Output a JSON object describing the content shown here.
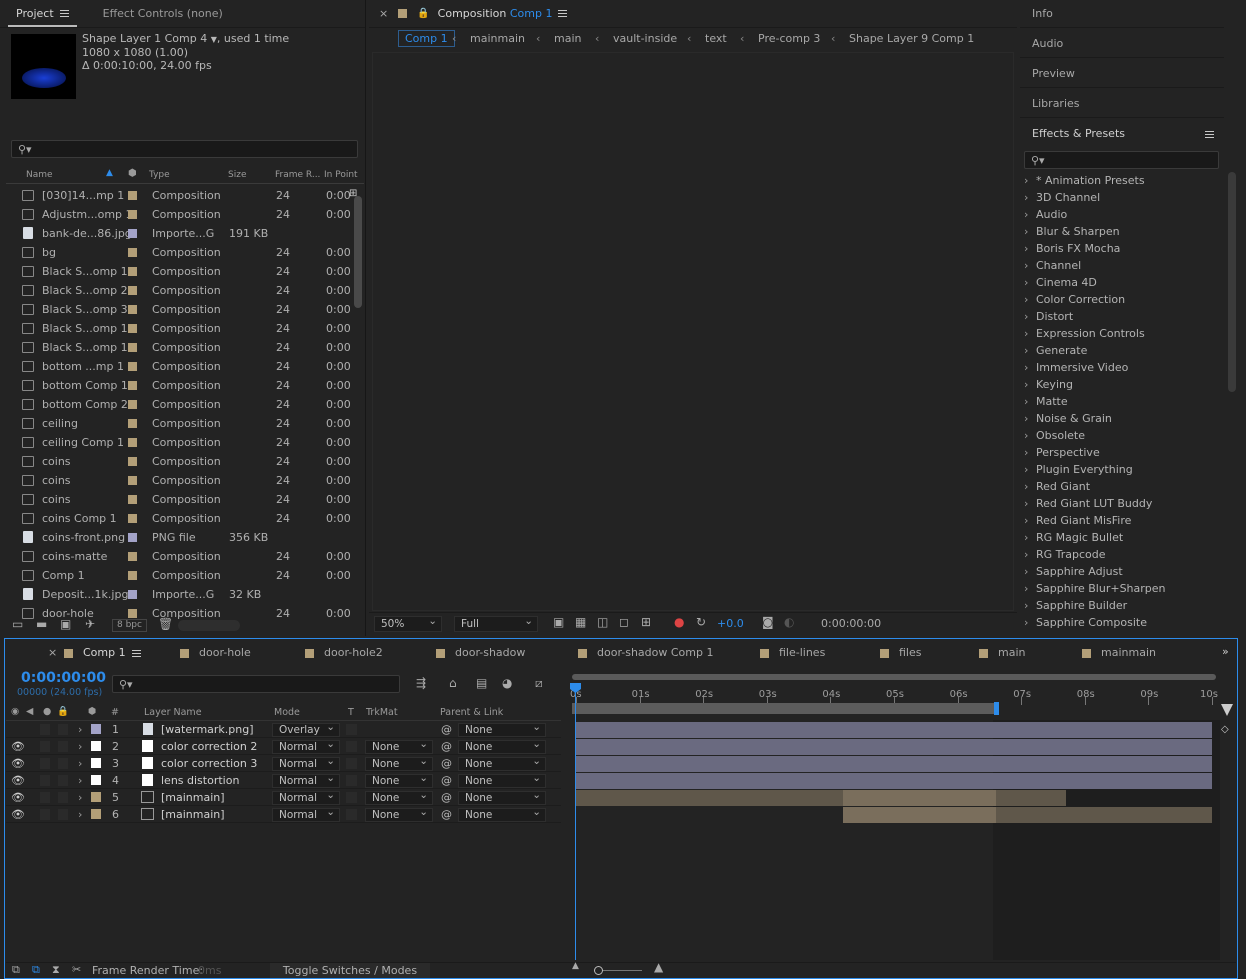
{
  "project_panel": {
    "tab_project": "Project",
    "tab_effect_controls": "Effect Controls (none)",
    "comp_name": "Shape Layer 1 Comp 4",
    "comp_used": ", used 1 time",
    "comp_res": "1080 x 1080 (1.00)",
    "comp_dur": "Δ 0:00:10:00, 24.00 fps",
    "columns": [
      "Name",
      "Type",
      "Size",
      "Frame R...",
      "In Point"
    ],
    "items": [
      {
        "name": "[030]14...mp 1",
        "type": "Composition",
        "size": "",
        "fr": "24",
        "in": "0:00",
        "icon": "comp",
        "color": "#b39f78"
      },
      {
        "name": "Adjustm...omp 1",
        "type": "Composition",
        "size": "",
        "fr": "24",
        "in": "0:00",
        "icon": "comp",
        "color": "#b39f78"
      },
      {
        "name": "bank-de...86.jpg",
        "type": "Importe...G",
        "size": "191 KB",
        "fr": "",
        "in": "",
        "icon": "file",
        "color": "#a3a3c8"
      },
      {
        "name": "bg",
        "type": "Composition",
        "size": "",
        "fr": "24",
        "in": "0:00",
        "icon": "comp",
        "color": "#b39f78"
      },
      {
        "name": "Black S...omp 1",
        "type": "Composition",
        "size": "",
        "fr": "24",
        "in": "0:00",
        "icon": "comp",
        "color": "#b39f78"
      },
      {
        "name": "Black S...omp 2",
        "type": "Composition",
        "size": "",
        "fr": "24",
        "in": "0:00",
        "icon": "comp",
        "color": "#b39f78"
      },
      {
        "name": "Black S...omp 3",
        "type": "Composition",
        "size": "",
        "fr": "24",
        "in": "0:00",
        "icon": "comp",
        "color": "#b39f78"
      },
      {
        "name": "Black S...omp 1",
        "type": "Composition",
        "size": "",
        "fr": "24",
        "in": "0:00",
        "icon": "comp",
        "color": "#b39f78"
      },
      {
        "name": "Black S...omp 1",
        "type": "Composition",
        "size": "",
        "fr": "24",
        "in": "0:00",
        "icon": "comp",
        "color": "#b39f78"
      },
      {
        "name": "bottom ...mp 1",
        "type": "Composition",
        "size": "",
        "fr": "24",
        "in": "0:00",
        "icon": "comp",
        "color": "#b39f78"
      },
      {
        "name": "bottom Comp 1",
        "type": "Composition",
        "size": "",
        "fr": "24",
        "in": "0:00",
        "icon": "comp",
        "color": "#b39f78"
      },
      {
        "name": "bottom Comp 2",
        "type": "Composition",
        "size": "",
        "fr": "24",
        "in": "0:00",
        "icon": "comp",
        "color": "#b39f78"
      },
      {
        "name": "ceiling",
        "type": "Composition",
        "size": "",
        "fr": "24",
        "in": "0:00",
        "icon": "comp",
        "color": "#b39f78"
      },
      {
        "name": "ceiling Comp 1",
        "type": "Composition",
        "size": "",
        "fr": "24",
        "in": "0:00",
        "icon": "comp",
        "color": "#b39f78"
      },
      {
        "name": "coins",
        "type": "Composition",
        "size": "",
        "fr": "24",
        "in": "0:00",
        "icon": "comp",
        "color": "#b39f78"
      },
      {
        "name": "coins",
        "type": "Composition",
        "size": "",
        "fr": "24",
        "in": "0:00",
        "icon": "comp",
        "color": "#b39f78"
      },
      {
        "name": "coins",
        "type": "Composition",
        "size": "",
        "fr": "24",
        "in": "0:00",
        "icon": "comp",
        "color": "#b39f78"
      },
      {
        "name": "coins Comp 1",
        "type": "Composition",
        "size": "",
        "fr": "24",
        "in": "0:00",
        "icon": "comp",
        "color": "#b39f78"
      },
      {
        "name": "coins-front.png",
        "type": "PNG file",
        "size": "356 KB",
        "fr": "",
        "in": "",
        "icon": "file",
        "color": "#a3a3c8"
      },
      {
        "name": "coins-matte",
        "type": "Composition",
        "size": "",
        "fr": "24",
        "in": "0:00",
        "icon": "comp",
        "color": "#b39f78"
      },
      {
        "name": "Comp 1",
        "type": "Composition",
        "size": "",
        "fr": "24",
        "in": "0:00",
        "icon": "comp",
        "color": "#b39f78"
      },
      {
        "name": "Deposit...1k.jpg",
        "type": "Importe...G",
        "size": "32 KB",
        "fr": "",
        "in": "",
        "icon": "file",
        "color": "#a3a3c8"
      },
      {
        "name": "door-hole",
        "type": "Composition",
        "size": "",
        "fr": "24",
        "in": "0:00",
        "icon": "comp",
        "color": "#b39f78"
      }
    ],
    "bpc": "8 bpc"
  },
  "composition_panel": {
    "tab_prefix": "Composition",
    "tab_name": "Comp 1",
    "breadcrumbs": [
      "Comp 1",
      "mainmain",
      "main",
      "vault-inside",
      "text",
      "Pre-comp 3",
      "Shape Layer 9 Comp 1"
    ],
    "zoom": "50%",
    "resolution": "Full",
    "exposure": "+0.0",
    "timecode": "0:00:00:00"
  },
  "right_panel": {
    "tabs": [
      "Info",
      "Audio",
      "Preview",
      "Libraries"
    ],
    "effects_title": "Effects & Presets",
    "effects": [
      "* Animation Presets",
      "3D Channel",
      "Audio",
      "Blur & Sharpen",
      "Boris FX Mocha",
      "Channel",
      "Cinema 4D",
      "Color Correction",
      "Distort",
      "Expression Controls",
      "Generate",
      "Immersive Video",
      "Keying",
      "Matte",
      "Noise & Grain",
      "Obsolete",
      "Perspective",
      "Plugin Everything",
      "Red Giant",
      "Red Giant LUT Buddy",
      "Red Giant MisFire",
      "RG Magic Bullet",
      "RG Trapcode",
      "Sapphire Adjust",
      "Sapphire Blur+Sharpen",
      "Sapphire Builder",
      "Sapphire Composite"
    ]
  },
  "timeline": {
    "tabs": [
      {
        "label": "Comp 1",
        "color": "#b39f78",
        "active": true
      },
      {
        "label": "door-hole",
        "color": "#b39f78"
      },
      {
        "label": "door-hole2",
        "color": "#b39f78"
      },
      {
        "label": "door-shadow",
        "color": "#b39f78"
      },
      {
        "label": "door-shadow Comp 1",
        "color": "#b39f78"
      },
      {
        "label": "file-lines",
        "color": "#b39f78"
      },
      {
        "label": "files",
        "color": "#b39f78"
      },
      {
        "label": "main",
        "color": "#b39f78"
      },
      {
        "label": "mainmain",
        "color": "#b39f78"
      }
    ],
    "timecode": "0:00:00:00",
    "frames": "00000 (24.00 fps)",
    "columns": {
      "layer_name": "Layer Name",
      "mode": "Mode",
      "t": "T",
      "trkmat": "TrkMat",
      "parent": "Parent & Link",
      "num": "#"
    },
    "ruler": [
      "0s",
      "01s",
      "02s",
      "03s",
      "04s",
      "05s",
      "06s",
      "07s",
      "08s",
      "09s",
      "10s"
    ],
    "layers": [
      {
        "num": "1",
        "name": "[watermark.png]",
        "mode": "Overlay",
        "trkmat": "",
        "parent": "None",
        "label": "#a3a3c8",
        "icon": "file",
        "start": 0,
        "end": 10
      },
      {
        "num": "2",
        "name": "color correction 2",
        "mode": "Normal",
        "trkmat": "None",
        "parent": "None",
        "label": "#ffffff",
        "icon": "solid",
        "start": 0,
        "end": 10
      },
      {
        "num": "3",
        "name": "color correction 3",
        "mode": "Normal",
        "trkmat": "None",
        "parent": "None",
        "label": "#ffffff",
        "icon": "solid",
        "start": 0,
        "end": 10
      },
      {
        "num": "4",
        "name": "lens distortion",
        "mode": "Normal",
        "trkmat": "None",
        "parent": "None",
        "label": "#ffffff",
        "icon": "solid",
        "start": 0,
        "end": 10
      },
      {
        "num": "5",
        "name": "[mainmain]",
        "mode": "Normal",
        "trkmat": "None",
        "parent": "None",
        "label": "#b39f78",
        "icon": "comp",
        "start": 0,
        "end": 7.7
      },
      {
        "num": "6",
        "name": "[mainmain]",
        "mode": "Normal",
        "trkmat": "None",
        "parent": "None",
        "label": "#b39f78",
        "icon": "comp",
        "start": 4.2,
        "end": 10
      }
    ],
    "work_area_end_seconds": 6.6,
    "footer": {
      "render_label": "Frame Render Time:",
      "render_value": "0ms",
      "toggle": "Toggle Switches / Modes"
    }
  },
  "colors": {
    "accent": "#2d8ceb",
    "panel": "#232323",
    "comp_label": "#b39f78",
    "file_label": "#a3a3c8"
  }
}
